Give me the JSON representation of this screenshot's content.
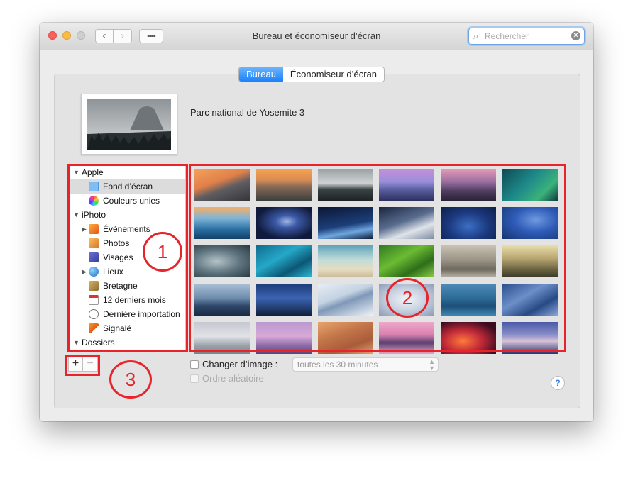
{
  "window": {
    "title": "Bureau et économiseur d’écran"
  },
  "search": {
    "placeholder": "Rechercher"
  },
  "tabs": [
    {
      "label": "Bureau",
      "active": true
    },
    {
      "label": "Économiseur d’écran",
      "active": false
    }
  ],
  "current_picture": {
    "name": "Parc national de Yosemite 3"
  },
  "sidebar": {
    "items": [
      {
        "label": "Apple",
        "level": 0,
        "disclosure": "open",
        "icon": ""
      },
      {
        "label": "Fond d’écran",
        "level": 1,
        "disclosure": "none",
        "icon": "folder-icon",
        "selected": true
      },
      {
        "label": "Couleurs unies",
        "level": 1,
        "disclosure": "none",
        "icon": "color-wheel-icon"
      },
      {
        "label": "iPhoto",
        "level": 0,
        "disclosure": "open",
        "icon": ""
      },
      {
        "label": "Événements",
        "level": 1,
        "disclosure": "closed",
        "icon": "events-icon"
      },
      {
        "label": "Photos",
        "level": 1,
        "disclosure": "none",
        "icon": "photos-icon"
      },
      {
        "label": "Visages",
        "level": 1,
        "disclosure": "none",
        "icon": "faces-icon"
      },
      {
        "label": "Lieux",
        "level": 1,
        "disclosure": "closed",
        "icon": "globe-icon"
      },
      {
        "label": "Bretagne",
        "level": 1,
        "disclosure": "none",
        "icon": "album-icon"
      },
      {
        "label": "12 derniers mois",
        "level": 1,
        "disclosure": "none",
        "icon": "calendar-icon"
      },
      {
        "label": "Dernière importation",
        "level": 1,
        "disclosure": "none",
        "icon": "import-icon"
      },
      {
        "label": "Signalé",
        "level": 1,
        "disclosure": "none",
        "icon": "flag-icon"
      },
      {
        "label": "Dossiers",
        "level": 0,
        "disclosure": "open",
        "icon": ""
      }
    ]
  },
  "buttons": {
    "add": "+",
    "remove": "−",
    "help": "?"
  },
  "options": {
    "change_picture_label": "Changer d’image :",
    "change_picture_checked": false,
    "interval_value": "toutes les 30 minutes",
    "random_order_label": "Ordre aléatoire",
    "random_order_checked": false
  },
  "annotations": [
    "1",
    "2",
    "3"
  ],
  "colors": {
    "accent": "#1a82fb",
    "annotation_red": "#e8232a",
    "window_bg": "#ececec",
    "panel_bg": "#e3e3e3"
  }
}
